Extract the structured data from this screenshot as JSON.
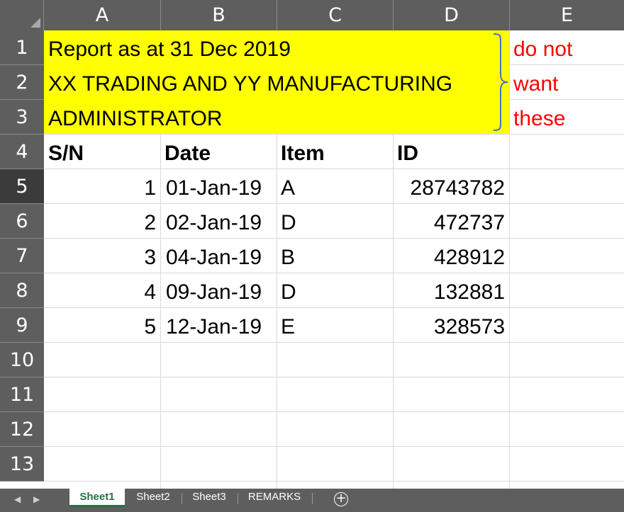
{
  "columns": [
    "A",
    "B",
    "C",
    "D",
    "E"
  ],
  "rows": [
    "1",
    "2",
    "3",
    "4",
    "5",
    "6",
    "7",
    "8",
    "9",
    "10",
    "11",
    "12",
    "13"
  ],
  "active_row": "5",
  "header_block": {
    "line1": "Report as at 31 Dec 2019",
    "line2": "XX TRADING AND YY MANUFACTURING",
    "line3": "ADMINISTRATOR",
    "fill_color": "#ffff00"
  },
  "annotation": {
    "line1": "do not",
    "line2": "want",
    "line3": "these",
    "color": "#ff0000"
  },
  "table": {
    "headers": [
      "S/N",
      "Date",
      "Item",
      "ID"
    ],
    "rows": [
      {
        "sn": "1",
        "date": "01-Jan-19",
        "item": "A",
        "id": "28743782"
      },
      {
        "sn": "2",
        "date": "02-Jan-19",
        "item": "D",
        "id": "472737"
      },
      {
        "sn": "3",
        "date": "04-Jan-19",
        "item": "B",
        "id": "428912"
      },
      {
        "sn": "4",
        "date": "09-Jan-19",
        "item": "D",
        "id": "132881"
      },
      {
        "sn": "5",
        "date": "12-Jan-19",
        "item": "E",
        "id": "328573"
      }
    ]
  },
  "sheet_tabs": [
    "Sheet1",
    "Sheet2",
    "Sheet3",
    "REMARKS"
  ],
  "active_tab": "Sheet1",
  "icons": {
    "scroll_left": "chevron-left-icon",
    "scroll_right": "chevron-right-icon",
    "add_sheet": "plus-circle-icon"
  },
  "colors": {
    "header_bg": "#5e5e5e",
    "active_tab_text": "#217346",
    "gridline": "#d9d9d9"
  }
}
